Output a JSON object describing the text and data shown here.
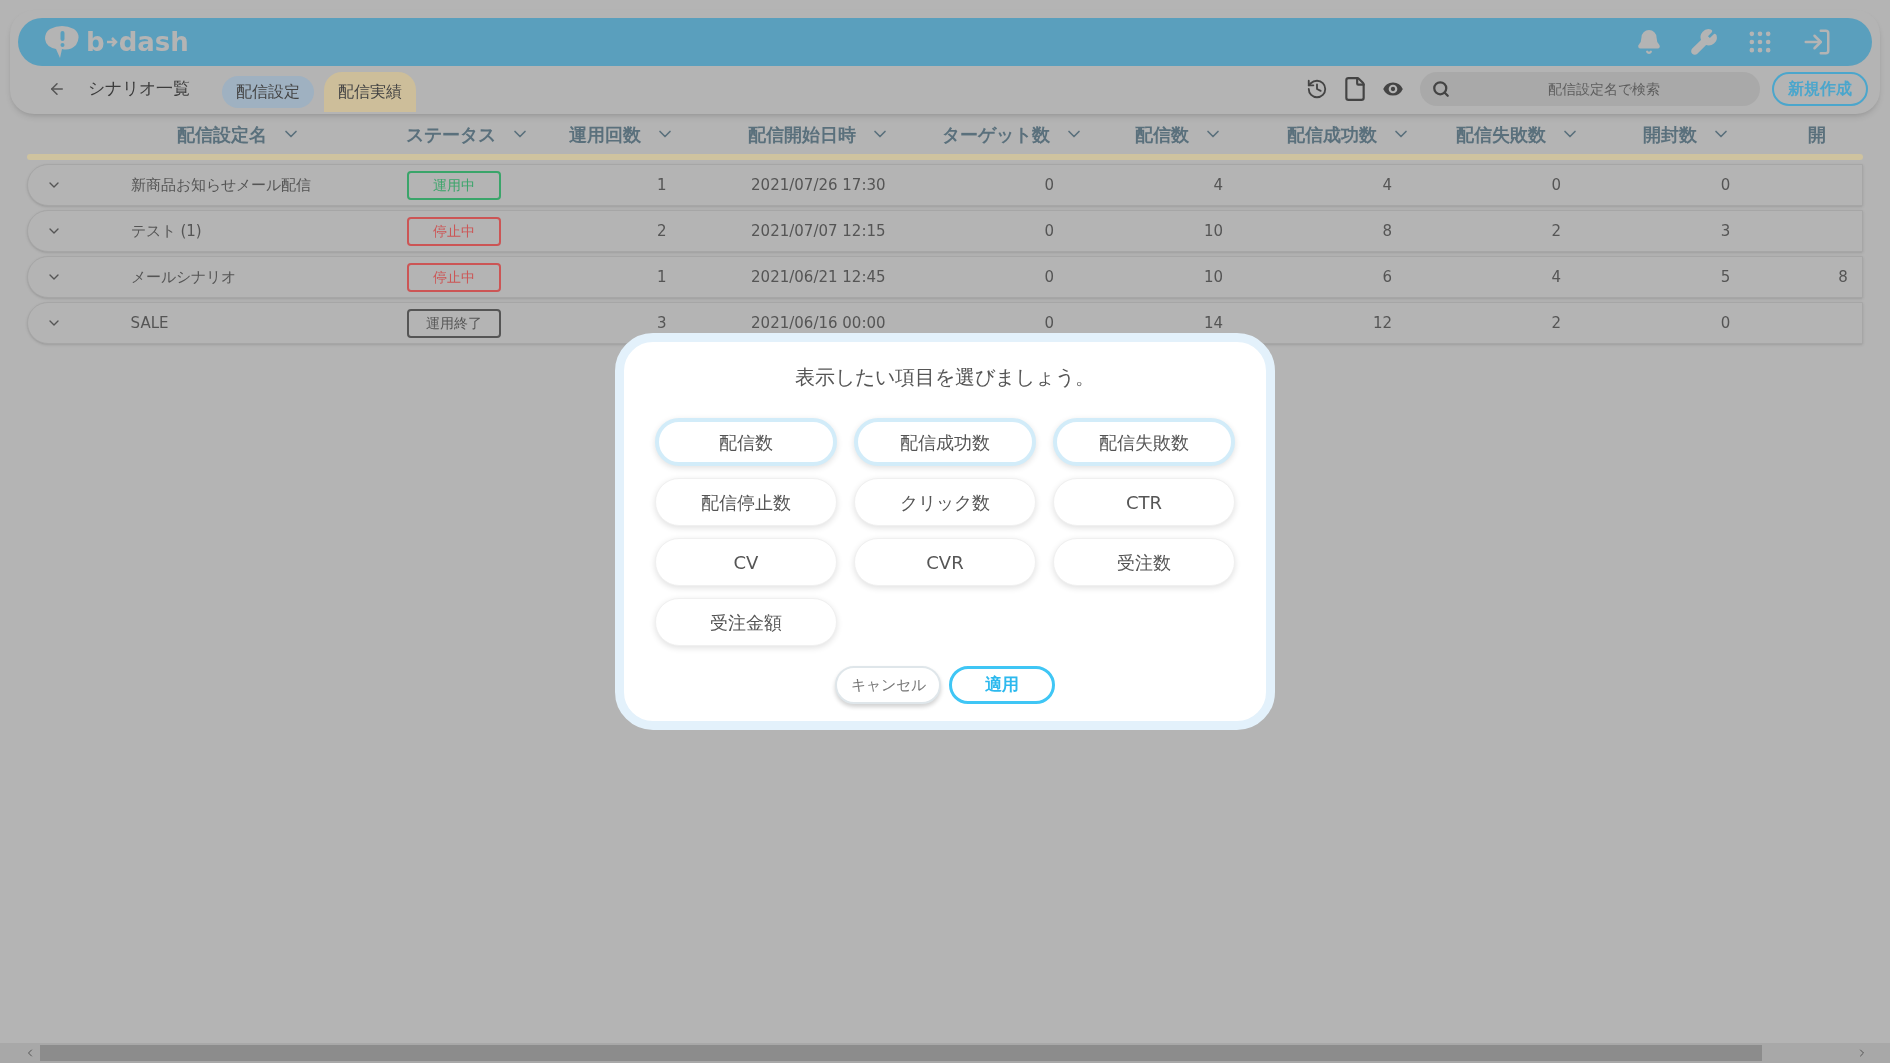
{
  "header": {
    "logo_left": "b",
    "logo_right": "dash"
  },
  "toolbar": {
    "back_label": "シナリオ一覧",
    "tabs": [
      {
        "label": "配信設定",
        "selected": false
      },
      {
        "label": "配信実績",
        "selected": true
      }
    ],
    "search": {
      "placeholder": "配信設定名で検索"
    },
    "new_button": "新規作成"
  },
  "table": {
    "columns": [
      "配信設定名",
      "ステータス",
      "運用回数",
      "配信開始日時",
      "ターゲット数",
      "配信数",
      "配信成功数",
      "配信失敗数",
      "開封数",
      "開"
    ],
    "rows": [
      {
        "name": "新商品お知らせメール配信",
        "status": {
          "label": "運用中",
          "color": "#3aa56a"
        },
        "runs": "1",
        "start": "2021/07/26 17:30",
        "targets": "0",
        "sent": "4",
        "success": "4",
        "failed": "0",
        "opened": "0"
      },
      {
        "name": "テスト (1)",
        "status": {
          "label": "停止中",
          "color": "#cc5555"
        },
        "runs": "2",
        "start": "2021/07/07 12:15",
        "targets": "0",
        "sent": "10",
        "success": "8",
        "failed": "2",
        "opened": "3"
      },
      {
        "name": "メールシナリオ",
        "status": {
          "label": "停止中",
          "color": "#cc5555"
        },
        "runs": "1",
        "start": "2021/06/21 12:45",
        "targets": "0",
        "sent": "10",
        "success": "6",
        "failed": "4",
        "opened": "5",
        "column_10": "8"
      },
      {
        "name": "SALE",
        "status": {
          "label": "運用終了",
          "color": "#555555"
        },
        "runs": "3",
        "start": "2021/06/16 00:00",
        "targets": "0",
        "sent": "14",
        "success": "12",
        "failed": "2",
        "opened": "0"
      }
    ]
  },
  "dialog": {
    "title": "表示したい項目を選びましょう。",
    "options": [
      {
        "label": "配信数",
        "selected": true
      },
      {
        "label": "配信成功数",
        "selected": true
      },
      {
        "label": "配信失敗数",
        "selected": true
      },
      {
        "label": "配信停止数",
        "selected": false
      },
      {
        "label": "クリック数",
        "selected": false
      },
      {
        "label": "CTR",
        "selected": false
      },
      {
        "label": "CV",
        "selected": false
      },
      {
        "label": "CVR",
        "selected": false
      },
      {
        "label": "受注数",
        "selected": false
      },
      {
        "label": "受注金額",
        "selected": false
      }
    ],
    "cancel": "キャンセル",
    "apply": "適用"
  }
}
